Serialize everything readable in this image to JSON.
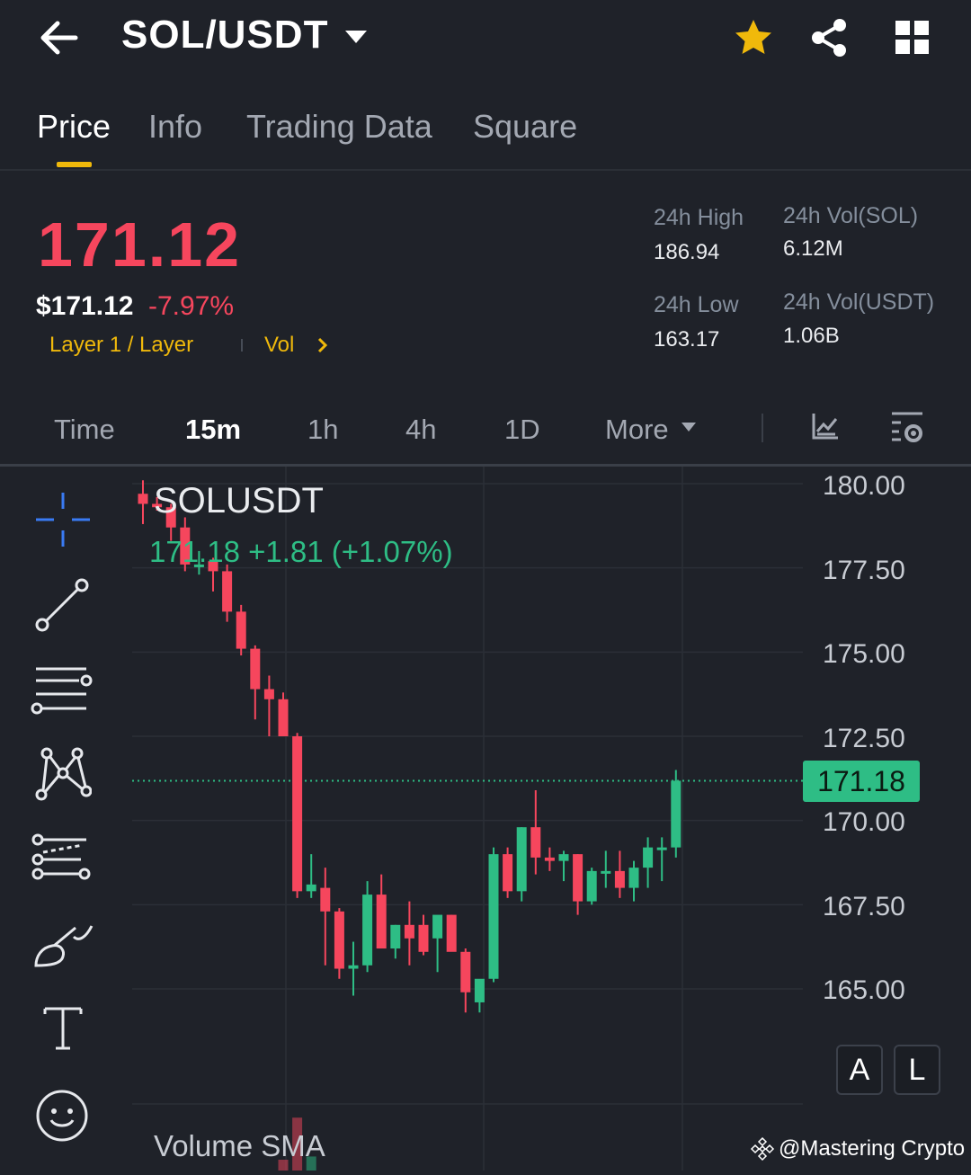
{
  "header": {
    "title": "SOL/USDT"
  },
  "tabs": [
    "Price",
    "Info",
    "Trading Data",
    "Square"
  ],
  "price": {
    "last": "171.12",
    "usd": "$171.12",
    "change": "-7.97%",
    "tags": [
      "Layer 1 / Layer",
      "Vol"
    ]
  },
  "stats": {
    "high_label": "24h High",
    "high": "186.94",
    "low_label": "24h Low",
    "low": "163.17",
    "vol_sol_label": "24h Vol(SOL)",
    "vol_sol": "6.12M",
    "vol_usdt_label": "24h Vol(USDT)",
    "vol_usdt": "1.06B"
  },
  "intervals": [
    "Time",
    "15m",
    "1h",
    "4h",
    "1D",
    "More"
  ],
  "chart_data": {
    "type": "candlestick",
    "title": "SOLUSDT",
    "ohlc_readout": "171.18  +1.81 (+1.07%)",
    "current_price": "171.18",
    "ylim": [
      163.2,
      181.2
    ],
    "y_ticks": [
      "180.00",
      "177.50",
      "175.00",
      "172.50",
      "170.00",
      "167.50",
      "165.00"
    ],
    "candles": [
      {
        "o": 179.7,
        "h": 180.1,
        "l": 178.8,
        "c": 179.4
      },
      {
        "o": 179.4,
        "h": 179.6,
        "l": 179.2,
        "c": 179.3
      },
      {
        "o": 179.3,
        "h": 179.4,
        "l": 178.3,
        "c": 178.7
      },
      {
        "o": 178.7,
        "h": 179.0,
        "l": 177.4,
        "c": 177.6
      },
      {
        "o": 177.6,
        "h": 178.0,
        "l": 177.3,
        "c": 177.6
      },
      {
        "o": 177.7,
        "h": 177.8,
        "l": 176.8,
        "c": 177.4
      },
      {
        "o": 177.4,
        "h": 177.6,
        "l": 175.9,
        "c": 176.2
      },
      {
        "o": 176.2,
        "h": 176.4,
        "l": 174.9,
        "c": 175.1
      },
      {
        "o": 175.1,
        "h": 175.2,
        "l": 173.0,
        "c": 173.9
      },
      {
        "o": 173.9,
        "h": 174.3,
        "l": 172.5,
        "c": 173.6
      },
      {
        "o": 173.6,
        "h": 173.8,
        "l": 172.8,
        "c": 172.5
      },
      {
        "o": 172.5,
        "h": 172.6,
        "l": 167.7,
        "c": 167.9
      },
      {
        "o": 167.9,
        "h": 169.0,
        "l": 167.7,
        "c": 168.1
      },
      {
        "o": 168.0,
        "h": 168.6,
        "l": 165.7,
        "c": 167.3
      },
      {
        "o": 167.3,
        "h": 167.4,
        "l": 165.3,
        "c": 165.6
      },
      {
        "o": 165.6,
        "h": 166.4,
        "l": 164.8,
        "c": 165.7
      },
      {
        "o": 165.7,
        "h": 168.2,
        "l": 165.5,
        "c": 167.8
      },
      {
        "o": 167.8,
        "h": 168.4,
        "l": 166.2,
        "c": 166.2
      },
      {
        "o": 166.2,
        "h": 166.9,
        "l": 165.9,
        "c": 166.9
      },
      {
        "o": 166.9,
        "h": 167.6,
        "l": 165.7,
        "c": 166.5
      },
      {
        "o": 166.9,
        "h": 167.2,
        "l": 166.0,
        "c": 166.1
      },
      {
        "o": 166.5,
        "h": 167.0,
        "l": 165.5,
        "c": 167.2
      },
      {
        "o": 167.2,
        "h": 167.2,
        "l": 166.4,
        "c": 166.1
      },
      {
        "o": 166.1,
        "h": 166.2,
        "l": 164.3,
        "c": 164.9
      },
      {
        "o": 164.6,
        "h": 165.1,
        "l": 164.3,
        "c": 165.3
      },
      {
        "o": 165.3,
        "h": 169.2,
        "l": 165.2,
        "c": 169.0
      },
      {
        "o": 169.0,
        "h": 169.2,
        "l": 167.7,
        "c": 167.9
      },
      {
        "o": 167.9,
        "h": 169.8,
        "l": 167.6,
        "c": 169.8
      },
      {
        "o": 169.8,
        "h": 170.9,
        "l": 168.4,
        "c": 168.9
      },
      {
        "o": 168.9,
        "h": 169.2,
        "l": 168.5,
        "c": 168.8
      },
      {
        "o": 168.8,
        "h": 169.1,
        "l": 168.2,
        "c": 169.0
      },
      {
        "o": 169.0,
        "h": 169.0,
        "l": 167.2,
        "c": 167.6
      },
      {
        "o": 167.6,
        "h": 168.6,
        "l": 167.5,
        "c": 168.5
      },
      {
        "o": 168.5,
        "h": 169.1,
        "l": 168.0,
        "c": 168.5
      },
      {
        "o": 168.5,
        "h": 169.1,
        "l": 167.7,
        "c": 168.0
      },
      {
        "o": 168.0,
        "h": 168.8,
        "l": 167.6,
        "c": 168.6
      },
      {
        "o": 168.6,
        "h": 169.5,
        "l": 168.0,
        "c": 169.2
      },
      {
        "o": 169.2,
        "h": 169.5,
        "l": 168.2,
        "c": 169.2
      },
      {
        "o": 169.2,
        "h": 171.5,
        "l": 168.9,
        "c": 171.18
      }
    ]
  },
  "controls": {
    "a": "A",
    "l": "L"
  },
  "volume_label": "Volume SMA",
  "watermark": "@Mastering Crypto",
  "colors": {
    "up": "#2ebd85",
    "down": "#f6465d",
    "accent": "#f0b90b",
    "bg": "#1f2229"
  }
}
